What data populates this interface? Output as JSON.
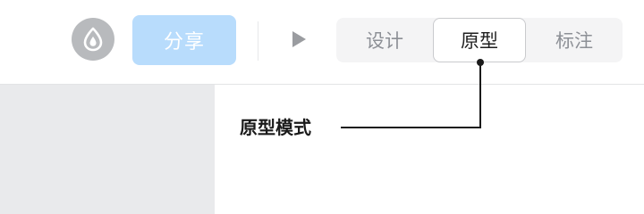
{
  "toolbar": {
    "logo_icon": "droplet-logo-icon",
    "share_label": "分享",
    "play_icon": "play-icon",
    "modes": [
      {
        "label": "设计",
        "active": false
      },
      {
        "label": "原型",
        "active": true
      },
      {
        "label": "标注",
        "active": false
      }
    ]
  },
  "callout": {
    "label": "原型模式"
  },
  "colors": {
    "share_bg": "#b8dcfc",
    "logo_bg": "#b8babd",
    "sidebar_bg": "#e9eaec",
    "segment_bg": "#f4f4f5"
  }
}
